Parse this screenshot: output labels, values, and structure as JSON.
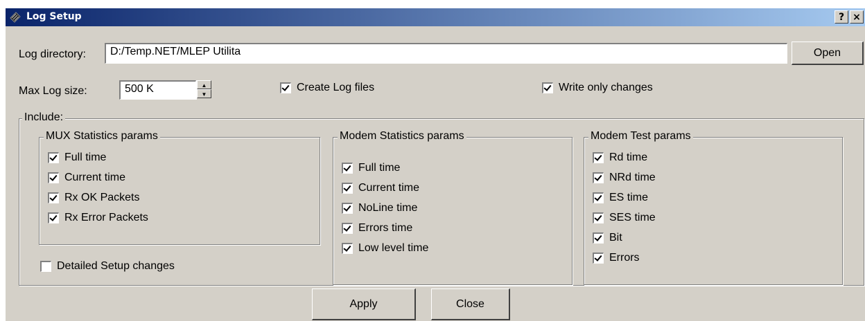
{
  "window": {
    "title": "Log Setup",
    "help_label": "?",
    "close_label": "×"
  },
  "log_directory": {
    "label": "Log directory:",
    "value": "D:/Temp.NET/MLEP Utilita",
    "open_label": "Open"
  },
  "max_log_size": {
    "label": "Max Log size:",
    "value": "500 K"
  },
  "create_log_files": {
    "label": "Create Log files",
    "checked": true
  },
  "write_only_changes": {
    "label": "Write only changes",
    "checked": true
  },
  "include": {
    "title": "Include:",
    "mux": {
      "title": "MUX Statistics params",
      "items": [
        {
          "label": "Full time",
          "checked": true
        },
        {
          "label": "Current time",
          "checked": true
        },
        {
          "label": "Rx OK Packets",
          "checked": true
        },
        {
          "label": "Rx Error Packets",
          "checked": true
        }
      ]
    },
    "detailed_setup": {
      "label": "Detailed Setup changes",
      "checked": false
    },
    "modem_stats": {
      "title": "Modem Statistics params",
      "items": [
        {
          "label": "Full time",
          "checked": true
        },
        {
          "label": "Current time",
          "checked": true
        },
        {
          "label": "NoLine time",
          "checked": true
        },
        {
          "label": "Errors time",
          "checked": true
        },
        {
          "label": "Low level time",
          "checked": true
        }
      ]
    },
    "modem_test": {
      "title": "Modem Test params",
      "items": [
        {
          "label": "Rd time",
          "checked": true
        },
        {
          "label": "NRd time",
          "checked": true
        },
        {
          "label": "ES time",
          "checked": true
        },
        {
          "label": "SES time",
          "checked": true
        },
        {
          "label": "Bit",
          "checked": true
        },
        {
          "label": "Errors",
          "checked": true
        }
      ]
    }
  },
  "footer": {
    "apply_label": "Apply",
    "close_label": "Close"
  }
}
